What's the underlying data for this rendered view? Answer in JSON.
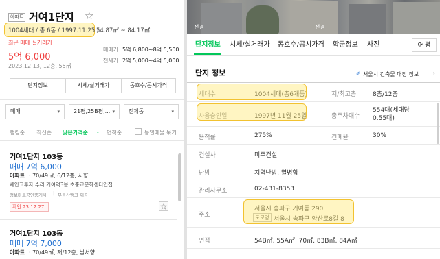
{
  "left": {
    "type_badge": "아파트",
    "complex_name": "거여1단지",
    "star": "☆",
    "summary_highlight": "1004세대 / 총 6동 / 1997.11.25 /",
    "summary_rest": "54.87㎡ ~ 84.17㎡",
    "recent_label": "최근 매매 실거래가",
    "recent_price": "5억 6,000",
    "recent_date": "2023.12.13, 12층, 55㎡",
    "sale_label": "매매가",
    "sale_value": "5억 6,800~8억 5,500",
    "jeonse_label": "전세가",
    "jeonse_value": "2억 5,000~4억 5,000",
    "buttons": [
      "단지정보",
      "시세/실거래가",
      "동호수/공시가격"
    ],
    "filters": {
      "trade": "매매",
      "area": "21평,25B평,...",
      "dong": "전체동"
    },
    "sort": {
      "ranking": "랭킹순",
      "latest": "최신순",
      "low_price": "낮은가격순",
      "low_price_arrow": "↓",
      "area": "면적순",
      "dup_checkbox_label": "동일매물 묶기"
    },
    "listings": [
      {
        "title": "거여1단지 103동",
        "price": "매매 7억 6,000",
        "type": "아파트",
        "spec": "· 70/49㎡, 6/12층, 서향",
        "desc": "세안고투자 수리 거여역3분 초중교문화센터인접",
        "source_a": "정보마트공인중개사",
        "source_b": "부동산뱅크 제공",
        "confirm": "확인 23.12.27."
      },
      {
        "title": "거여1단지 103동",
        "price": "매매 7억 7,000",
        "type": "아파트",
        "spec": "· 70/49㎡, 저/12층, 남서향"
      }
    ]
  },
  "right": {
    "photo_labels": [
      "전경",
      "전경"
    ],
    "tabs": [
      "단지정보",
      "시세/실거래가",
      "동호수/공시가격",
      "학군정보",
      "사진"
    ],
    "refresh_label": "평",
    "section_title": "단지 정보",
    "building_info_link": "서울시 건축물 대장 정보",
    "table": {
      "households_label": "세대수",
      "households_value": "1004세대(총6개동)",
      "floors_label": "저/최고층",
      "floors_value": "8층/12층",
      "approval_label": "사용승인일",
      "approval_value": "1997년 11월 25일",
      "parking_label": "총주차대수",
      "parking_value": "554대(세대당 0.55대)",
      "far_label": "용적률",
      "far_value": "275%",
      "bcr_label": "건폐율",
      "bcr_value": "30%",
      "builder_label": "건설사",
      "builder_value": "미주건설",
      "heating_label": "난방",
      "heating_value": "지역난방, 열병합",
      "office_label": "관리사무소",
      "office_value": "02-431-8353",
      "address_label": "주소",
      "address_lot": "서울시 송파구 거여동 290",
      "road_badge": "도로명",
      "address_road": "서울시 송파구 양산로8길 8",
      "area_label": "면적",
      "area_value": "54B㎡, 55A㎡, 70㎡, 83B㎡, 84A㎡"
    }
  }
}
